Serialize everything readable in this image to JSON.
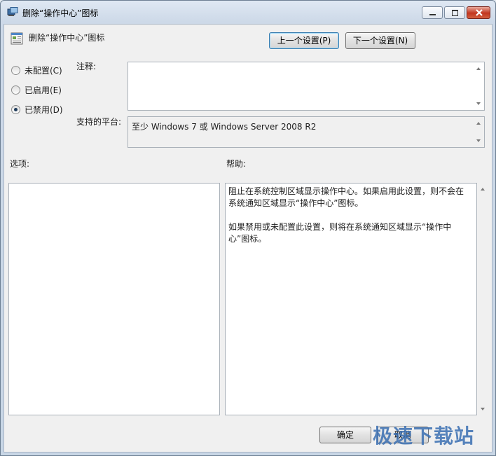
{
  "window": {
    "title": "删除“操作中心”图标",
    "controls": {
      "minimize": "minimize",
      "maximize": "maximize",
      "close": "close"
    }
  },
  "header": {
    "policy_title": "删除“操作中心”图标",
    "prev_button": "上一个设置(P)",
    "next_button": "下一个设置(N)"
  },
  "state": {
    "options": [
      {
        "label": "未配置(C)",
        "selected": false
      },
      {
        "label": "已启用(E)",
        "selected": false
      },
      {
        "label": "已禁用(D)",
        "selected": true
      }
    ]
  },
  "comment": {
    "label": "注释:",
    "value": ""
  },
  "platform": {
    "label": "支持的平台:",
    "value": "至少 Windows 7 或 Windows Server 2008 R2"
  },
  "options_section": {
    "label": "选项:"
  },
  "help_section": {
    "label": "帮助:",
    "paragraphs": [
      "阻止在系统控制区域显示操作中心。如果启用此设置，则不会在系统通知区域显示“操作中心”图标。",
      "如果禁用或未配置此设置，则将在系统通知区域显示“操作中心”图标。"
    ]
  },
  "footer": {
    "ok_button": "确定",
    "cancel_button": "取消"
  },
  "watermark": "极速下载站"
}
